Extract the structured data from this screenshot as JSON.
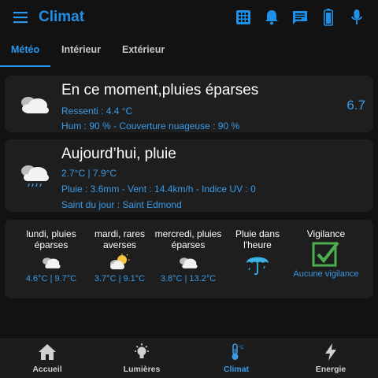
{
  "header": {
    "title": "Climat",
    "icons": [
      "menu-icon",
      "grid-icon",
      "bell-icon",
      "message-icon",
      "battery-icon",
      "microphone-icon"
    ]
  },
  "tabs": [
    {
      "label": "Météo",
      "active": true
    },
    {
      "label": "Intérieur",
      "active": false
    },
    {
      "label": "Extérieur",
      "active": false
    }
  ],
  "now": {
    "title": "En ce moment,pluies éparses",
    "line1": "Ressenti : 4.4 °C",
    "line2": "Hum : 90 % - Couverture nuageuse : 90 %",
    "value": "6.7",
    "icon": "cloudy-icon"
  },
  "today": {
    "title": "Aujourd’hui, pluie",
    "line1": "2.7°C | 7.9°C",
    "line2": "Pluie : 3.6mm - Vent : 14.4km/h - Indice UV : 0",
    "line3": "Saint du jour : Saint Edmond",
    "icon": "rain-icon"
  },
  "forecast": [
    {
      "label1": "lundi, pluies",
      "label2": "éparses",
      "temps": "4.6°C | 9.7°C",
      "icon": "cloudy-icon"
    },
    {
      "label1": "mardi, rares",
      "label2": "averses",
      "temps": "3.7°C | 9.1°C",
      "icon": "partly-sunny-icon"
    },
    {
      "label1": "mercredi, pluies",
      "label2": "éparses",
      "temps": "3.8°C | 13.2°C",
      "icon": "cloudy-icon"
    }
  ],
  "rain_hour": {
    "label1": "Pluie dans",
    "label2": "l'heure",
    "icon": "umbrella-icon"
  },
  "vigilance": {
    "label": "Vigilance",
    "status": "Aucune vigilance",
    "icon": "checkbox-icon"
  },
  "nav": [
    {
      "label": "Accueil",
      "icon": "home-icon",
      "active": false
    },
    {
      "label": "Lumières",
      "icon": "lightbulb-icon",
      "active": false
    },
    {
      "label": "Climat",
      "icon": "thermometer-icon",
      "active": true
    },
    {
      "label": "Energie",
      "icon": "lightning-icon",
      "active": false
    }
  ],
  "colors": {
    "accent": "#2a97ee",
    "background": "#121212",
    "card": "#1e1e1e",
    "vigilance_green": "#4caf50"
  }
}
